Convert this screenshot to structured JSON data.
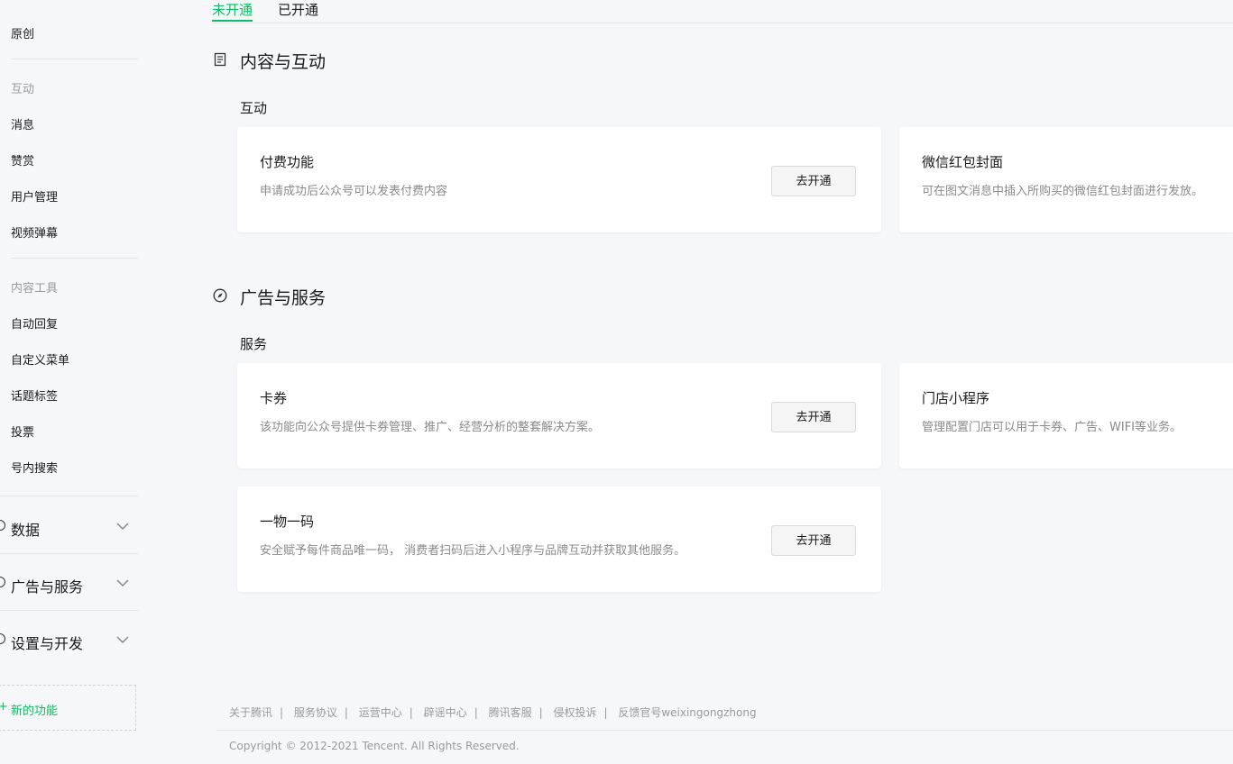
{
  "sidebar": {
    "items_top": [
      "原创"
    ],
    "group_interact": "互动",
    "interact_items": [
      "消息",
      "赞赏",
      "用户管理",
      "视频弹幕"
    ],
    "group_tools": "内容工具",
    "tool_items": [
      "自动回复",
      "自定义菜单",
      "话题标签",
      "投票",
      "号内搜索"
    ],
    "menus": [
      "数据",
      "广告与服务",
      "设置与开发"
    ],
    "new_feature_label": "新的功能"
  },
  "tabs": [
    "未开通",
    "已开通"
  ],
  "sections": [
    {
      "title": "内容与互动",
      "subtitle": "互动",
      "cards": [
        {
          "title": "付费功能",
          "desc": "申请成功后公众号可以发表付费内容",
          "button": "去开通"
        },
        {
          "title": "微信红包封面",
          "desc": "可在图文消息中插入所购买的微信红包封面进行发放。"
        }
      ]
    },
    {
      "title": "广告与服务",
      "subtitle": "服务",
      "cards": [
        {
          "title": "卡券",
          "desc": "该功能向公众号提供卡券管理、推广、经营分析的整套解决方案。",
          "button": "去开通"
        },
        {
          "title": "门店小程序",
          "desc": "管理配置门店可以用于卡券、广告、WIFI等业务。"
        },
        {
          "title": "一物一码",
          "desc": "安全赋予每件商品唯一码， 消费者扫码后进入小程序与品牌互动并获取其他服务。",
          "button": "去开通"
        }
      ]
    }
  ],
  "footer": {
    "links": [
      "关于腾讯",
      "服务协议",
      "运营中心",
      "辟谣中心",
      "腾讯客服",
      "侵权投诉",
      "反馈官号weixingongzhong"
    ],
    "copyright": "Copyright © 2012-2021 Tencent. All Rights Reserved."
  },
  "colors": {
    "accent": "#07c160",
    "background": "#f6f7f9"
  }
}
